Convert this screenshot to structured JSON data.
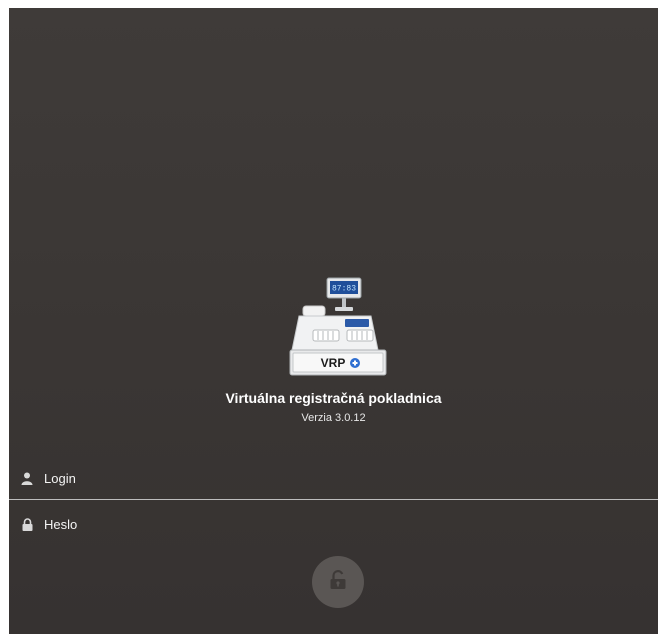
{
  "app": {
    "title": "Virtuálna registračná pokladnica",
    "version": "Verzia 3.0.12",
    "logo": {
      "text": "VRP",
      "display": "87:83",
      "icon": "cash-register-icon"
    }
  },
  "form": {
    "login_label": "Login",
    "password_label": "Heslo",
    "login_icon": "user-icon",
    "password_icon": "lock-icon"
  },
  "actions": {
    "unlock_icon": "unlock-icon"
  },
  "colors": {
    "background": "#3a3634",
    "button": "#5a5654",
    "text": "#ffffff",
    "divider": "#bdbdbd"
  }
}
